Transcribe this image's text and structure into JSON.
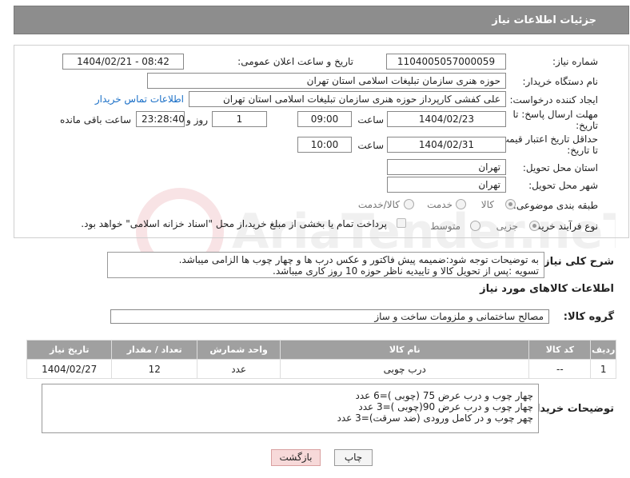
{
  "header": {
    "title": "جزئیات اطلاعات نیاز"
  },
  "form": {
    "need_number_label": "شماره نیاز:",
    "need_number": "1104005057000059",
    "announce_label": "تاریخ و ساعت اعلان عمومی:",
    "announce_value": "1404/02/21 - 08:42",
    "buyer_org_label": "نام دستگاه خریدار:",
    "buyer_org": "حوزه هنری سازمان تبلیغات اسلامی استان تهران",
    "requester_label": "ایجاد کننده درخواست:",
    "requester": "علی کفشی کارپرداز حوزه هنری سازمان تبلیغات اسلامی استان تهران",
    "contact_link": "اطلاعات تماس خریدار",
    "reply_deadline_label_1": "مهلت ارسال پاسخ: تا",
    "reply_deadline_label_2": "تاریخ:",
    "reply_date": "1404/02/23",
    "time_label": "ساعت",
    "reply_time": "09:00",
    "days_value": "1",
    "days_label": "روز و",
    "remaining_value": "23:28:40",
    "remaining_label": "ساعت باقی مانده",
    "price_validity_label_1": "حداقل تاریخ اعتبار قیمت:",
    "price_validity_label_2": "تا تاریخ:",
    "price_date": "1404/02/31",
    "price_time": "10:00",
    "delivery_province_label": "استان محل تحویل:",
    "delivery_province": "تهران",
    "delivery_city_label": "شهر محل تحویل:",
    "delivery_city": "تهران",
    "category_label": "طبقه بندی موضوعی:",
    "category_options": [
      "کالا",
      "خدمت",
      "کالا/خدمت"
    ],
    "process_label": "نوع فرآیند خرید :",
    "process_options": [
      "جزیی",
      "متوسط"
    ],
    "payment_note": "پرداخت تمام یا بخشی از مبلغ خرید،از محل \"اسناد خزانه اسلامی\" خواهد بود."
  },
  "description": {
    "label": "شرح کلی نیاز:",
    "line1": "به توضیحات توجه شود:ضمیمه پیش فاکتور و عکس درب ها و چهار چوب ها الزامی میباشد.",
    "line2": "تسویه :پس از تحویل کالا و تاییدیه ناظر حوزه 10 روز کاری میباشد."
  },
  "goods": {
    "section_title": "اطلاعات کالاهای مورد نیاز",
    "group_label": "گروه کالا:",
    "group_value": "مصالح ساختمانی و ملزومات ساخت و ساز",
    "columns": [
      "ردیف",
      "کد کالا",
      "نام کالا",
      "واحد شمارش",
      "تعداد / مقدار",
      "تاریخ نیاز"
    ],
    "rows": [
      [
        "1",
        "--",
        "درب چوبی",
        "عدد",
        "12",
        "1404/02/27"
      ]
    ]
  },
  "buyer_notes": {
    "label": "توضیحات خریدار:",
    "line1": "چهار چوب و درب عرض 75 (چوبی )=6 عدد",
    "line2": "چهار چوب و درب عرض 90(چوبی )=3 عدد",
    "line3": "چهر چوب و در کامل ورودی (ضد سرقت)=3 عدد"
  },
  "buttons": {
    "print": "چاپ",
    "back": "بازگشت"
  },
  "watermark": {
    "text": "AriaTender.neT"
  }
}
